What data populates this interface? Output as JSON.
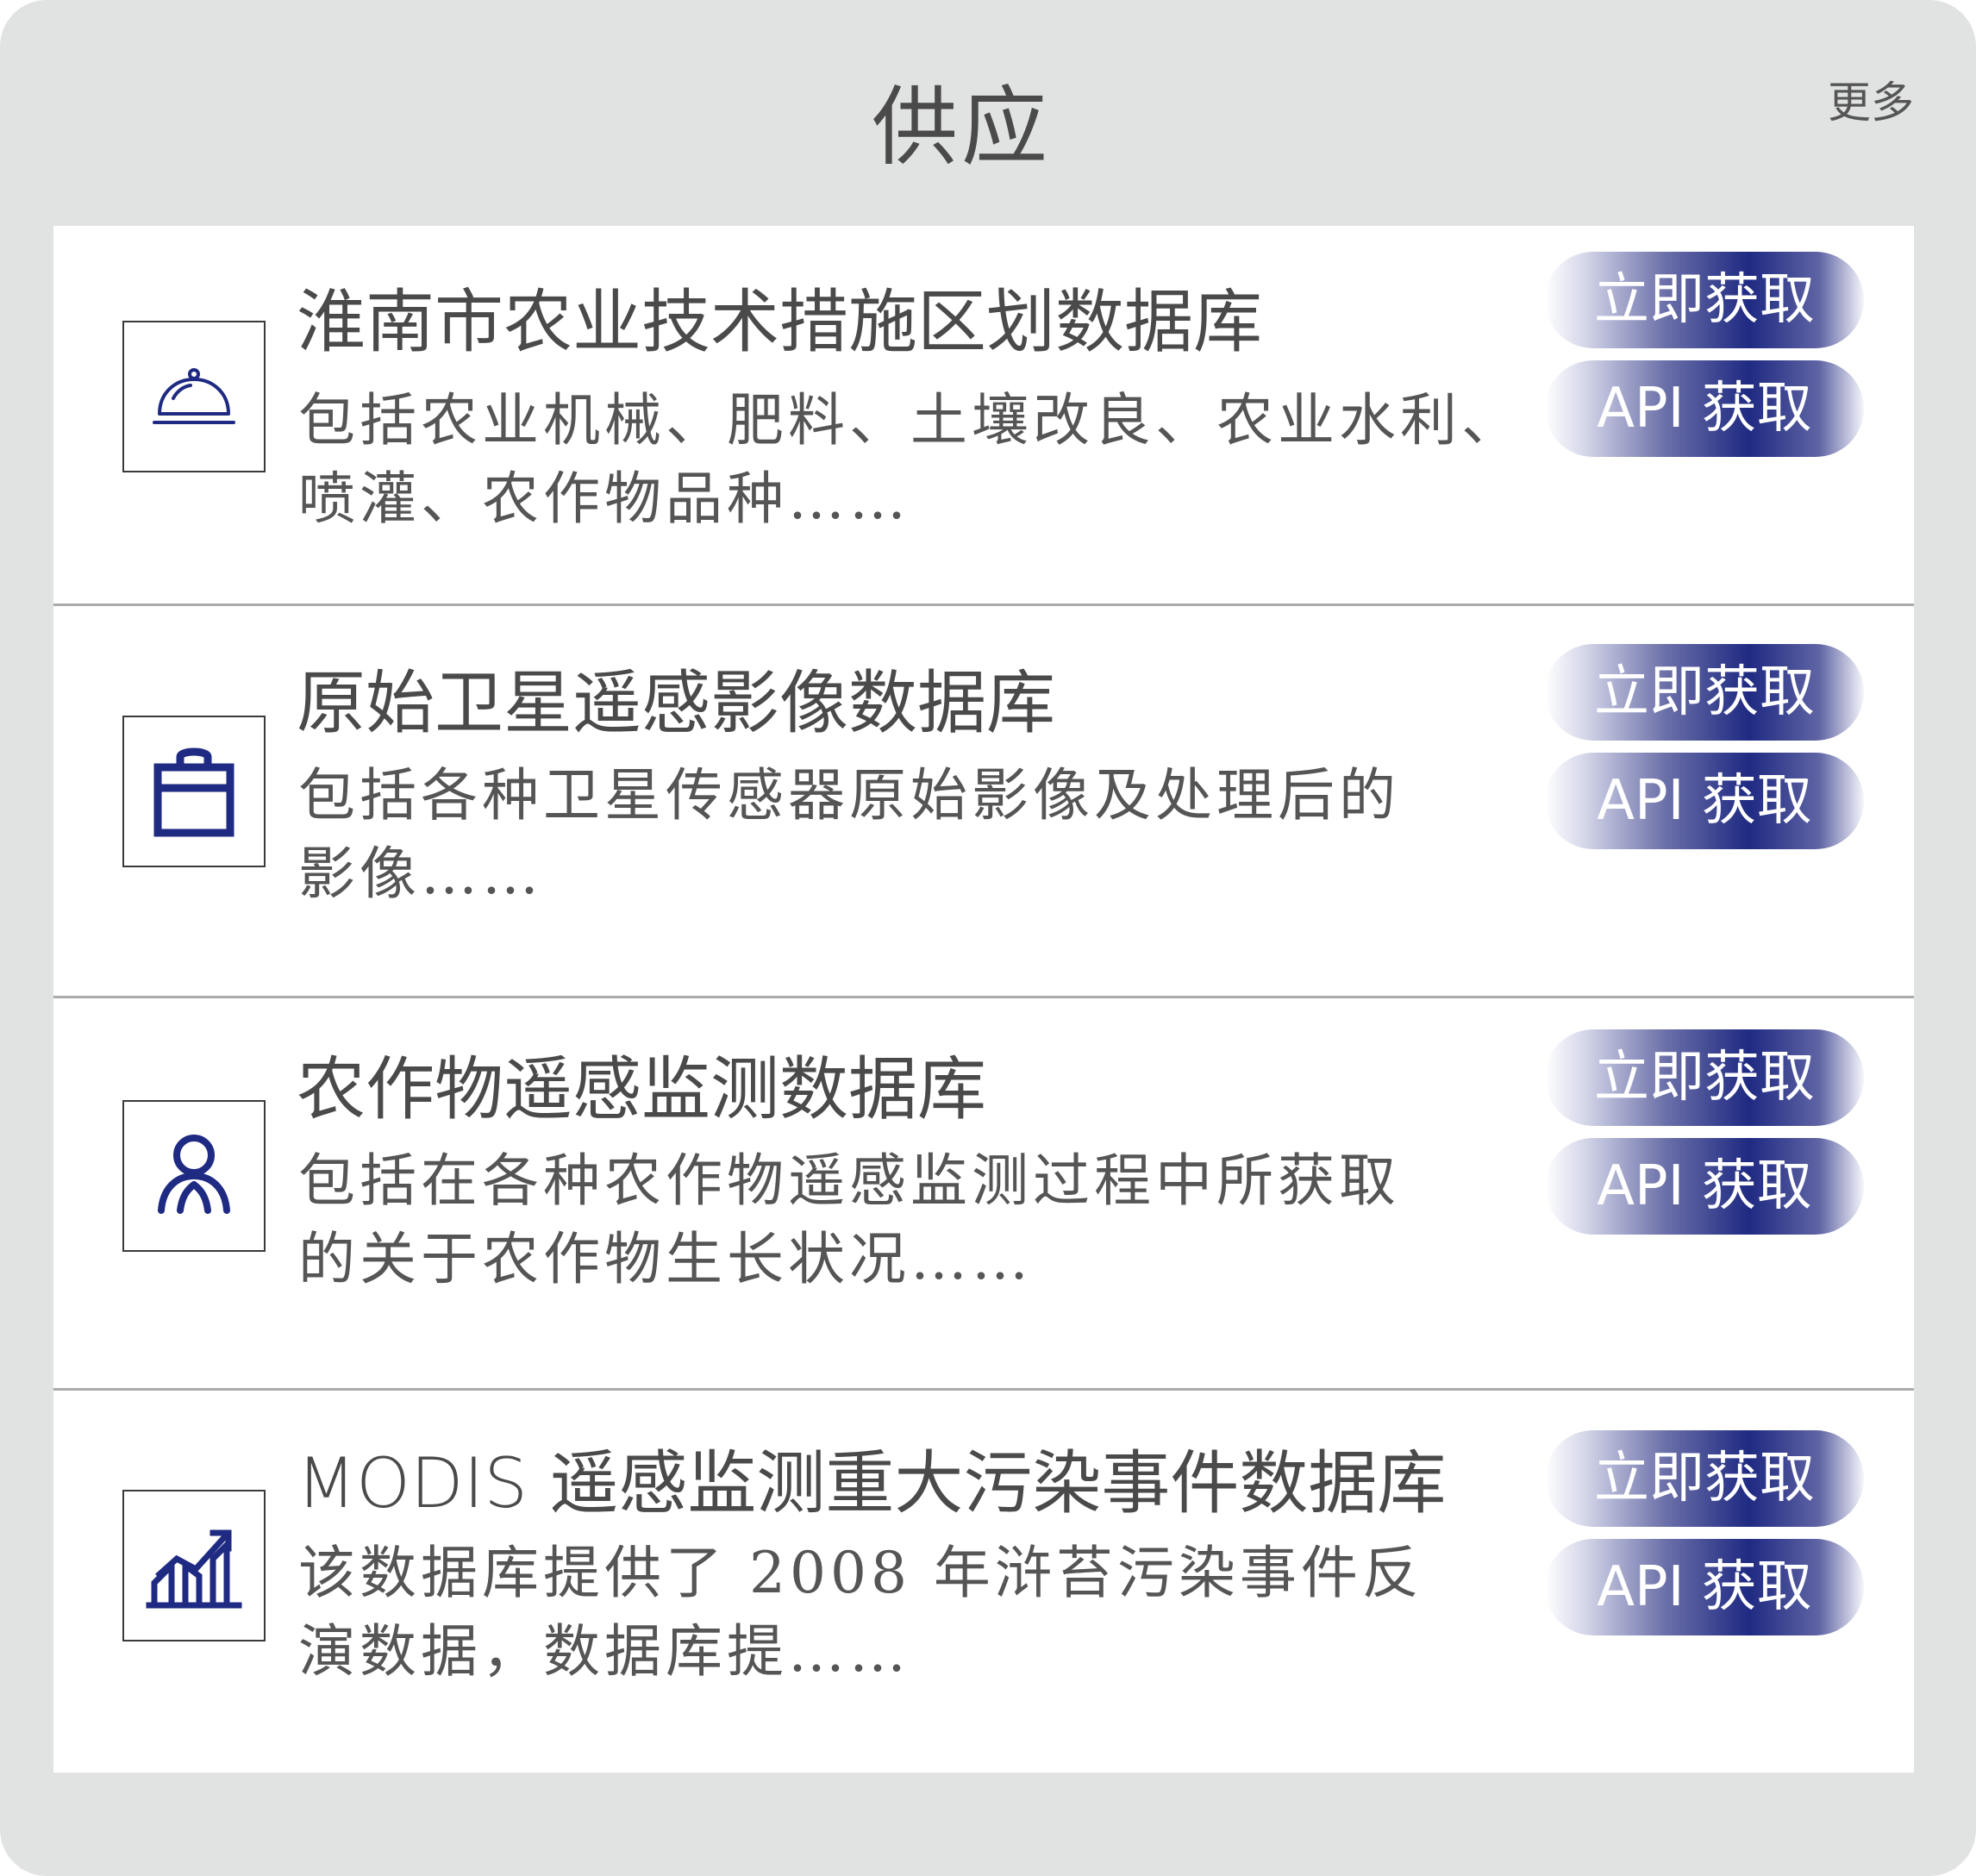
{
  "header": {
    "title": "供应",
    "more": "更多"
  },
  "items": [
    {
      "icon": "food-cover-icon",
      "title": "淮南市农业技术措施区划数据库",
      "desc_line1": "包括农业机械、肥料、土壤改良、农业水利、",
      "desc_line2": "喷灌、农作物品种……",
      "btn_get": "立即获取",
      "btn_api": "API 获取"
    },
    {
      "icon": "shopping-bag-icon",
      "title": "原始卫星遥感影像数据库",
      "desc_line1": "包括各种卫星传感器原始影像及处理后的",
      "desc_line2": "影像……",
      "btn_get": "立即获取",
      "btn_api": "API 获取"
    },
    {
      "icon": "user-icon",
      "title": "农作物遥感监测数据库",
      "desc_line1": "包括在各种农作物遥感监测过程中所获取",
      "desc_line2": "的关于农作物生长状况……",
      "btn_get": "立即获取",
      "btn_api": "API 获取"
    },
    {
      "icon": "growth-chart-icon",
      "title": "MODIS 遥感监测重大污染事件数据库",
      "desc_line1": "该数据库提供了 2008 年浒苔污染事件反",
      "desc_line2": "演数据，数据库提……",
      "btn_get": "立即获取",
      "btn_api": "API 获取"
    }
  ],
  "colors": {
    "icon": "#1f2a82",
    "button_core": "#1f2a82",
    "background": "#e1e2e2"
  }
}
